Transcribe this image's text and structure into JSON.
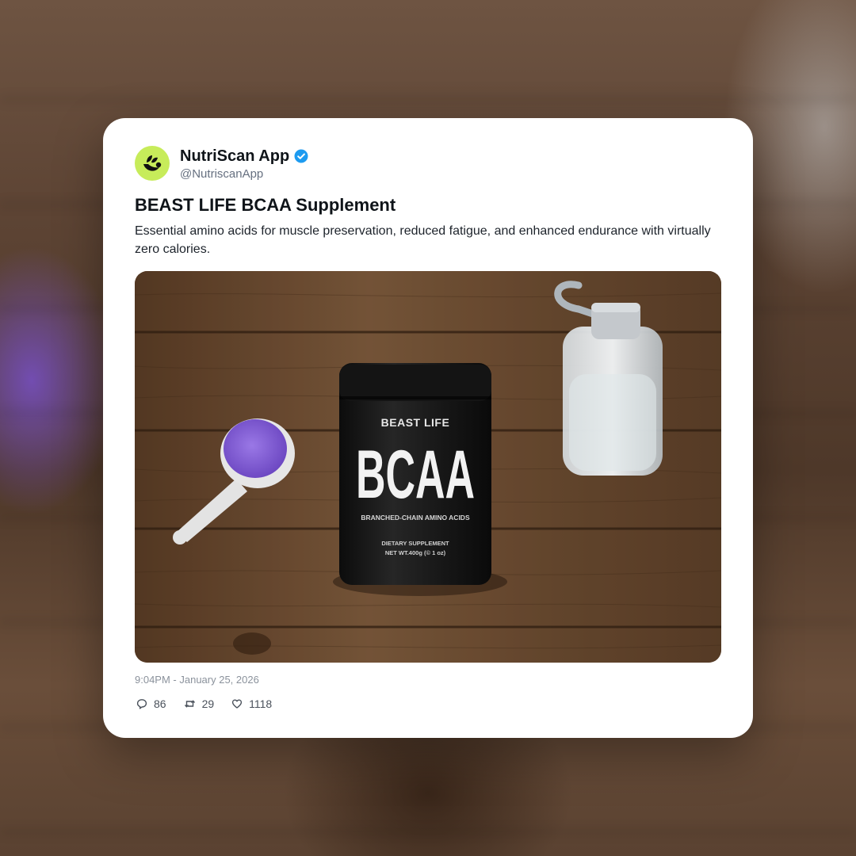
{
  "account": {
    "display_name": "NutriScan App",
    "handle": "@NutriscanApp",
    "verified": true,
    "avatar_color": "#c7ec5a"
  },
  "post": {
    "title": "BEAST LIFE BCAA Supplement",
    "description": "Essential amino acids for muscle preservation, reduced fatigue, and enhanced endurance with virtually zero calories.",
    "timestamp": "9:04PM - January 25, 2026"
  },
  "image": {
    "jar_brand": "BEAST LIFE",
    "jar_name": "BCAA",
    "jar_subtitle": "BRANCHED-CHAIN AMINO ACIDS",
    "jar_line1": "DIETARY SUPPLEMENT",
    "jar_line2": "NET WT.400g (© 1 oz)",
    "powder_color": "#7d5ad1"
  },
  "stats": {
    "replies": "86",
    "reposts": "29",
    "likes": "1118"
  },
  "colors": {
    "verified_badge": "#1d9bf0",
    "card_background": "#ffffff"
  }
}
